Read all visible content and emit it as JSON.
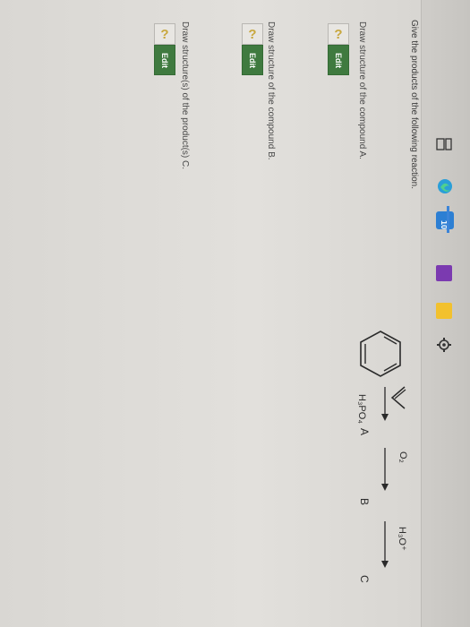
{
  "question": {
    "prompt": "Give the products of the following reaction."
  },
  "parts": [
    {
      "label": "Draw structure of the compound A.",
      "button": "Edit",
      "placeholder": "?"
    },
    {
      "label": "Draw structure of the compound B.",
      "button": "Edit",
      "placeholder": "?"
    },
    {
      "label": "Draw structure(s) of the product(s) C.",
      "button": "Edit",
      "placeholder": "?"
    }
  ],
  "reaction": {
    "reagent1_top": "",
    "reagent1_bottom": "H₃PO₄",
    "product1": "A",
    "reagent2_top": "O₂",
    "product2": "B",
    "reagent3_top": "H₃O⁺",
    "product3": "C"
  },
  "taskbar": {
    "badge": "10",
    "icons": [
      "settings-icon",
      "store-icon",
      "onenote-icon",
      "mail-icon",
      "edge-icon",
      "task-view-icon",
      "search-icon"
    ]
  },
  "colors": {
    "edit_button": "#3f7a3f",
    "question_mark": "#c8a73d"
  }
}
